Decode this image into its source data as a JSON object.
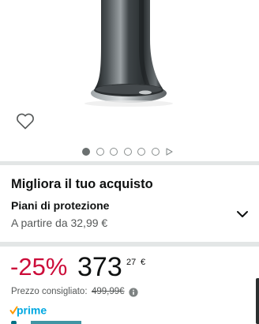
{
  "gallery": {
    "image_label": "product image",
    "dot_count": 6,
    "active_dot": 0,
    "has_video_indicator": true
  },
  "upsell": {
    "title": "Migliora il tuo acquisto",
    "protection_title": "Piani di protezione",
    "protection_price": "A partire da 32,99 €"
  },
  "price": {
    "discount": "-25%",
    "whole": "373",
    "fraction": "27",
    "currency": "€",
    "list_price_label": "Prezzo consigliato:",
    "list_price_value": "499,99€",
    "prime_label": "prime"
  },
  "colors": {
    "discount": "#cc0c39",
    "prime_blue": "#00a8e1",
    "prime_check": "#ff9900",
    "separator": "#e3e6e6"
  },
  "icons": {
    "wishlist": "heart-icon",
    "expand": "chevron-down-icon",
    "info": "info-icon",
    "video": "play-icon"
  }
}
